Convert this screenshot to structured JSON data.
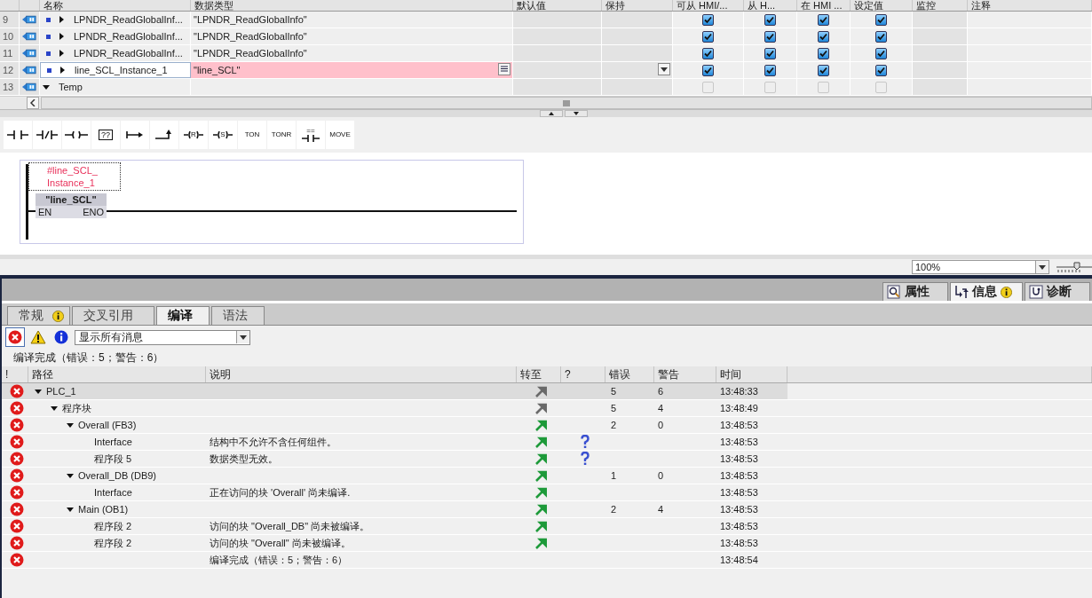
{
  "object_table": {
    "columns": [
      "名称",
      "数据类型",
      "默认值",
      "保持",
      "可从 HMI/...",
      "从 H...",
      "在 HMI ...",
      "设定值",
      "监控",
      "注释"
    ],
    "rows": [
      {
        "number": "9",
        "kind": "member",
        "expanded": false,
        "name": "LPNDR_ReadGlobalInf...",
        "data_type": "\"LPNDR_ReadGlobalInfo\"",
        "selected": false,
        "error": false,
        "flags_enabled": true,
        "flags": [
          true,
          true,
          true,
          true
        ]
      },
      {
        "number": "10",
        "kind": "member",
        "expanded": false,
        "name": "LPNDR_ReadGlobalInf...",
        "data_type": "\"LPNDR_ReadGlobalInfo\"",
        "selected": false,
        "error": false,
        "flags_enabled": true,
        "flags": [
          true,
          true,
          true,
          true
        ]
      },
      {
        "number": "11",
        "kind": "member",
        "expanded": false,
        "name": "LPNDR_ReadGlobalInf...",
        "data_type": "\"LPNDR_ReadGlobalInfo\"",
        "selected": false,
        "error": false,
        "flags_enabled": true,
        "flags": [
          true,
          true,
          true,
          true
        ]
      },
      {
        "number": "12",
        "kind": "member",
        "expanded": false,
        "name": "line_SCL_Instance_1",
        "data_type": "\"line_SCL\"",
        "selected": true,
        "error": true,
        "flags_enabled": true,
        "flags": [
          true,
          true,
          true,
          true
        ]
      },
      {
        "number": "13",
        "kind": "section",
        "expanded": true,
        "name": "Temp",
        "selected": false,
        "error": false,
        "flags_enabled": false,
        "flags": [
          false,
          false,
          false,
          false
        ]
      }
    ]
  },
  "instructions": [
    {
      "kind": "contact-no"
    },
    {
      "kind": "contact-nc"
    },
    {
      "kind": "coil"
    },
    {
      "kind": "box",
      "label": "??"
    },
    {
      "kind": "open-branch"
    },
    {
      "kind": "close-branch"
    },
    {
      "kind": "coil-letter",
      "label": "R"
    },
    {
      "kind": "coil-letter",
      "label": "S"
    },
    {
      "kind": "text",
      "label": "TON"
    },
    {
      "kind": "text",
      "label": "TONR"
    },
    {
      "kind": "compare",
      "label": "=="
    },
    {
      "kind": "text",
      "label": "MOVE"
    }
  ],
  "network": {
    "instance_lines": [
      "#line_SCL_",
      "Instance_1"
    ],
    "block": "\"line_SCL\"",
    "input": "EN",
    "output": "ENO"
  },
  "zoom": {
    "value": "100%"
  },
  "inspector_tabs": [
    {
      "label": "属性",
      "kind": "properties",
      "selected": false,
      "badge": false
    },
    {
      "label": "信息",
      "kind": "info",
      "selected": true,
      "badge": true
    },
    {
      "label": "诊断",
      "kind": "diagnostics",
      "selected": false,
      "badge": false
    }
  ],
  "sub_tabs": [
    {
      "label": "常规",
      "selected": false,
      "badge": true
    },
    {
      "label": "交叉引用",
      "selected": false,
      "badge": false
    },
    {
      "label": "编译",
      "selected": true,
      "badge": false
    },
    {
      "label": "语法",
      "selected": false,
      "badge": false
    }
  ],
  "filters": [
    {
      "kind": "error",
      "selected": true
    },
    {
      "kind": "warning",
      "selected": false
    },
    {
      "kind": "info",
      "selected": false
    }
  ],
  "filter_dropdown": "显示所有消息",
  "summary": "编译完成（错误：5；警告：6）",
  "messages": {
    "columns": [
      "!",
      "路径",
      "说明",
      "转至",
      "?",
      "错误",
      "警告",
      "时间"
    ],
    "rows": [
      {
        "error": true,
        "path": "PLC_1",
        "expanded": true,
        "goto_active": false,
        "help": false,
        "errors": "5",
        "warnings": "6",
        "time": "13:48:33",
        "selected": true,
        "children": [
          {
            "error": true,
            "path": "程序块",
            "expanded": true,
            "goto_active": false,
            "help": false,
            "errors": "5",
            "warnings": "4",
            "time": "13:48:49",
            "selected": false,
            "children": [
              {
                "error": true,
                "path": "Overall (FB3)",
                "expanded": true,
                "goto_active": true,
                "help": false,
                "errors": "2",
                "warnings": "0",
                "time": "13:48:53",
                "selected": false,
                "children": [
                  {
                    "error": true,
                    "path": "Interface",
                    "description": "结构中不允许不含任何组件。",
                    "goto_active": true,
                    "help": true,
                    "time": "13:48:53",
                    "selected": false
                  },
                  {
                    "error": true,
                    "path": "程序段 5",
                    "description": "数据类型无效。",
                    "goto_active": true,
                    "help": true,
                    "time": "13:48:53",
                    "selected": false
                  }
                ]
              },
              {
                "error": true,
                "path": "Overall_DB (DB9)",
                "expanded": true,
                "goto_active": true,
                "help": false,
                "errors": "1",
                "warnings": "0",
                "time": "13:48:53",
                "selected": false,
                "children": [
                  {
                    "error": true,
                    "path": "Interface",
                    "description": "正在访问的块 'Overall' 尚未编译.",
                    "goto_active": true,
                    "help": false,
                    "time": "13:48:53",
                    "selected": false
                  }
                ]
              },
              {
                "error": true,
                "path": "Main (OB1)",
                "expanded": true,
                "goto_active": true,
                "help": false,
                "errors": "2",
                "warnings": "4",
                "time": "13:48:53",
                "selected": false,
                "children": [
                  {
                    "error": true,
                    "path": "程序段 2",
                    "description": "访问的块 \"Overall_DB\" 尚未被编译。",
                    "goto_active": true,
                    "help": false,
                    "time": "13:48:53",
                    "selected": false
                  },
                  {
                    "error": true,
                    "path": "程序段 2",
                    "description": "访问的块 \"Overall\" 尚未被编译。",
                    "goto_active": true,
                    "help": false,
                    "time": "13:48:53",
                    "selected": false
                  }
                ]
              }
            ]
          }
        ]
      },
      {
        "error": true,
        "description": "编译完成（错误：5；警告：6）",
        "help": false,
        "time": "13:48:54",
        "selected": false
      }
    ]
  }
}
